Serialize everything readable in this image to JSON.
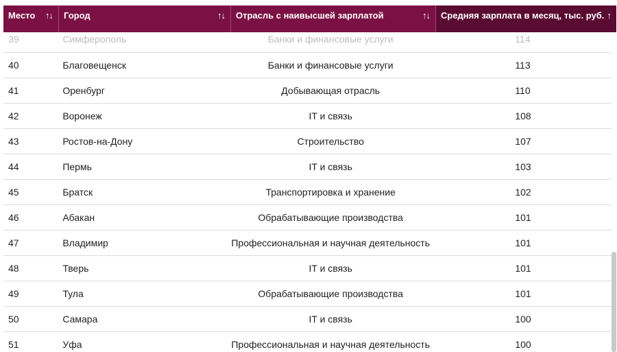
{
  "table": {
    "headers": [
      {
        "label": "Место",
        "sort_icon": "↑↓"
      },
      {
        "label": "Город",
        "sort_icon": "↑↓"
      },
      {
        "label": "Отрасль с наивысшей зарплатой",
        "sort_icon": "↑↓"
      },
      {
        "label": "Средняя зарплата в месяц, тыс. руб.",
        "sort_icon": "↑"
      }
    ],
    "rows": [
      {
        "place": "39",
        "city": "Симферополь",
        "industry": "Банки и финансовые услуги",
        "salary": "114"
      },
      {
        "place": "40",
        "city": "Благовещенск",
        "industry": "Банки и финансовые услуги",
        "salary": "113"
      },
      {
        "place": "41",
        "city": "Оренбург",
        "industry": "Добывающая отрасль",
        "salary": "110"
      },
      {
        "place": "42",
        "city": "Воронеж",
        "industry": "IT и связь",
        "salary": "108"
      },
      {
        "place": "43",
        "city": "Ростов-на-Дону",
        "industry": "Строительство",
        "salary": "107"
      },
      {
        "place": "44",
        "city": "Пермь",
        "industry": "IT и связь",
        "salary": "103"
      },
      {
        "place": "45",
        "city": "Братск",
        "industry": "Транспортировка и хранение",
        "salary": "102"
      },
      {
        "place": "46",
        "city": "Абакан",
        "industry": "Обрабатывающие производства",
        "salary": "101"
      },
      {
        "place": "47",
        "city": "Владимир",
        "industry": "Профессиональная и научная деятельность",
        "salary": "101"
      },
      {
        "place": "48",
        "city": "Тверь",
        "industry": "IT и связь",
        "salary": "101"
      },
      {
        "place": "49",
        "city": "Тула",
        "industry": "Обрабатывающие производства",
        "salary": "101"
      },
      {
        "place": "50",
        "city": "Самара",
        "industry": "IT и связь",
        "salary": "100"
      },
      {
        "place": "51",
        "city": "Уфа",
        "industry": "Профессиональная и научная деятельность",
        "salary": "100"
      }
    ]
  },
  "colors": {
    "header_bg": "#7b1044",
    "header_active_bg": "#5a0b32",
    "header_text": "#ffffff",
    "row_border": "#dcdcdc"
  }
}
